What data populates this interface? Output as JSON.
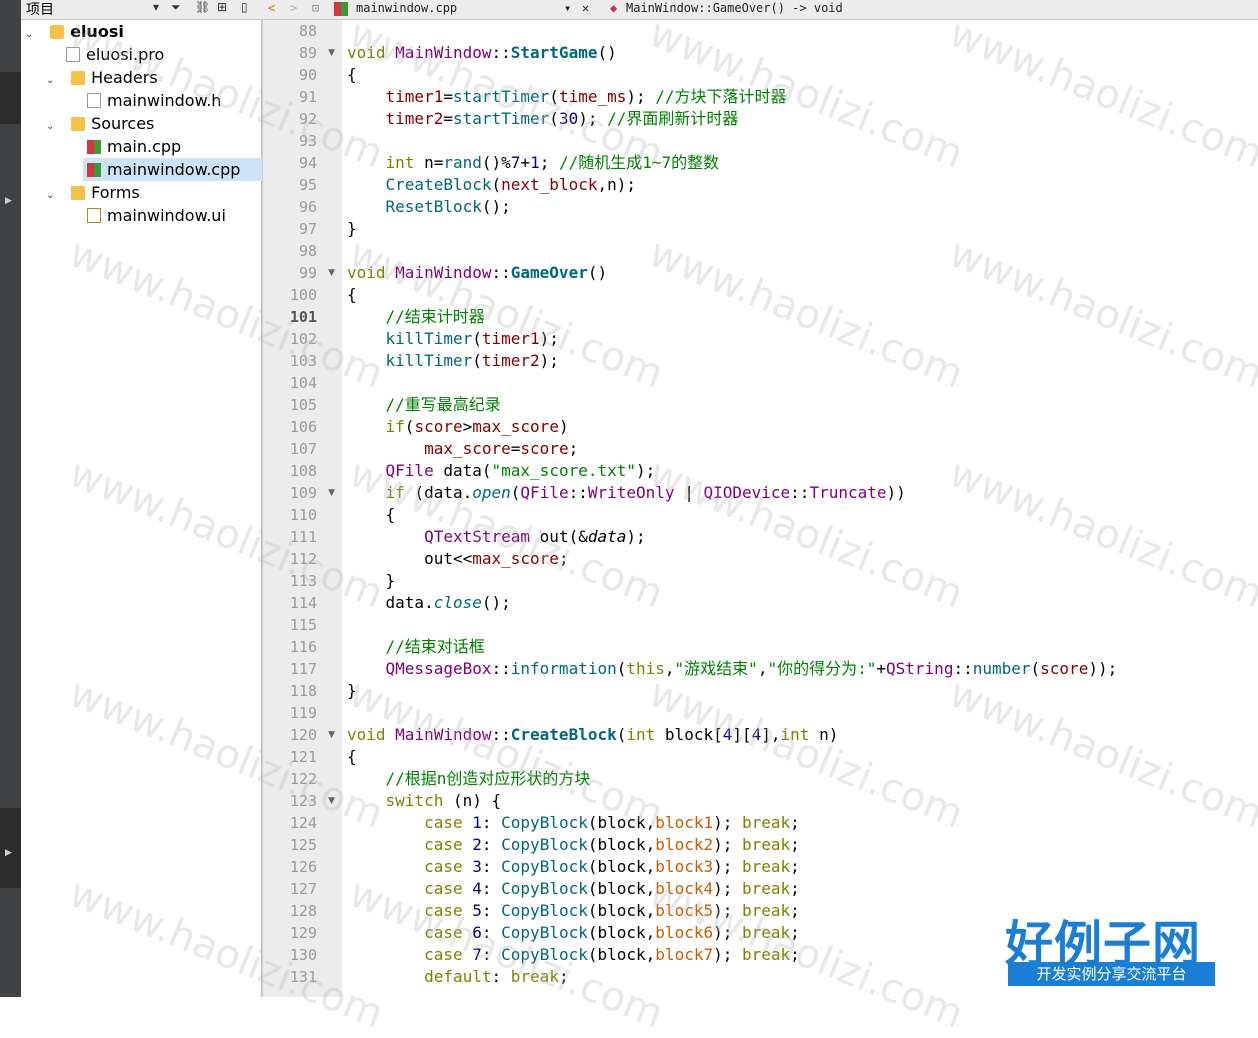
{
  "project_panel": {
    "title": "项目",
    "tree": [
      {
        "label": "eluosi",
        "icon": "qt-project-icon",
        "expanded": true
      },
      {
        "label": "eluosi.pro",
        "icon": "pro-file-icon"
      },
      {
        "label": "Headers",
        "icon": "headers-folder-icon",
        "expanded": true
      },
      {
        "label": "mainwindow.h",
        "icon": "header-file-icon"
      },
      {
        "label": "Sources",
        "icon": "sources-folder-icon",
        "expanded": true
      },
      {
        "label": "main.cpp",
        "icon": "cpp-file-icon"
      },
      {
        "label": "mainwindow.cpp",
        "icon": "cpp-file-icon",
        "selected": true
      },
      {
        "label": "Forms",
        "icon": "forms-folder-icon",
        "expanded": true
      },
      {
        "label": "mainwindow.ui",
        "icon": "ui-file-icon"
      }
    ]
  },
  "editor_bar": {
    "file": "mainwindow.cpp",
    "symbol": "MainWindow::GameOver() -> void"
  },
  "editor": {
    "current_line": "101",
    "lines": [
      "88",
      "89",
      "90",
      "91",
      "92",
      "93",
      "94",
      "95",
      "96",
      "97",
      "98",
      "99",
      "100",
      "101",
      "102",
      "103",
      "104",
      "105",
      "106",
      "107",
      "108",
      "109",
      "110",
      "111",
      "112",
      "113",
      "114",
      "115",
      "116",
      "117",
      "118",
      "119",
      "120",
      "121",
      "122",
      "123",
      "124",
      "125",
      "126",
      "127",
      "128",
      "129",
      "130",
      "131"
    ],
    "comments": {
      "c91": "//方块下落计时器",
      "c92": "//界面刷新计时器",
      "c94": "//随机生成1~7的整数",
      "c101": "//结束计时器",
      "c105": "//重写最高纪录",
      "c116": "//结束对话框",
      "c122": "//根据n创造对应形状的方块"
    },
    "strings": {
      "s108": "\"max_score.txt\"",
      "s117a": "\"游戏结束\"",
      "s117b": "\"你的得分为:\""
    }
  },
  "watermark": "www.haolizi.com",
  "logo": {
    "title": "好例子网",
    "subtitle": "开发实例分享交流平台"
  }
}
